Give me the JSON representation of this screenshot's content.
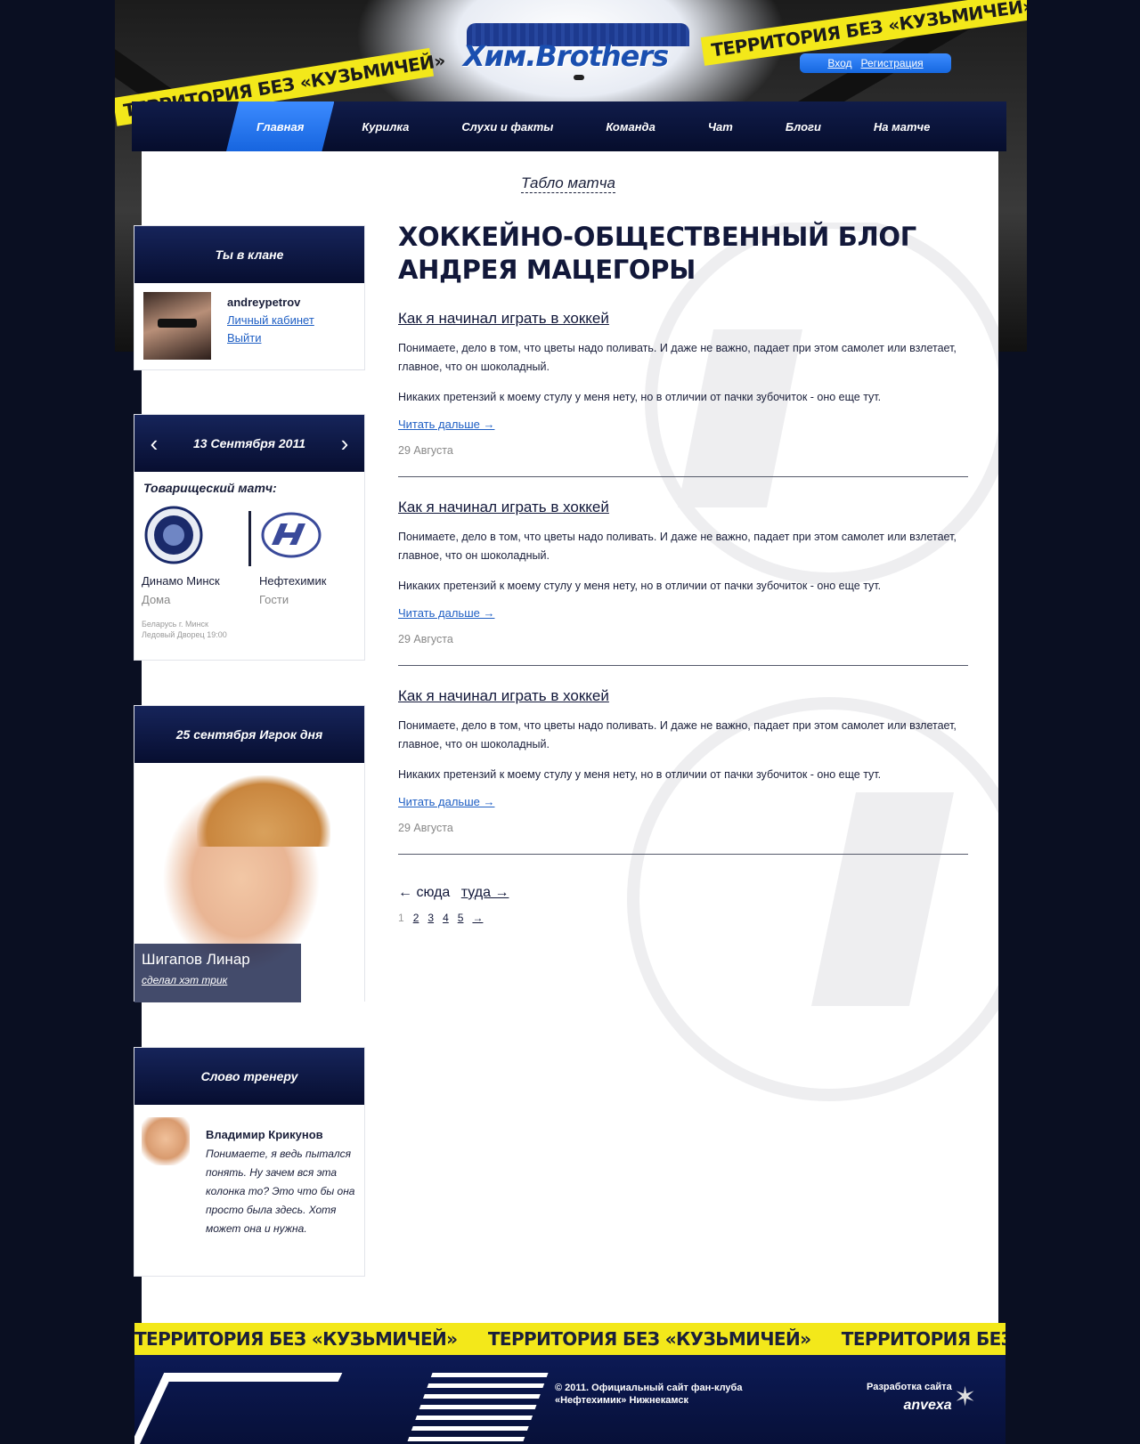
{
  "header": {
    "logo_text": "Хим.Brothers",
    "tape_text": "ТЕРРИТОРИЯ БЕЗ «КУЗЬМИЧЕЙ»",
    "auth": {
      "login": "Вход",
      "register": "Регистрация"
    }
  },
  "nav": {
    "items": [
      {
        "label": "Главная",
        "active": true
      },
      {
        "label": "Курилка"
      },
      {
        "label": "Слухи и факты"
      },
      {
        "label": "Команда"
      },
      {
        "label": "Чат"
      },
      {
        "label": "Блоги"
      },
      {
        "label": "На матче"
      }
    ]
  },
  "scoreboard_link": "Табло матча",
  "sidebar": {
    "clan": {
      "title": "Ты в клане",
      "username": "andreypetrov",
      "cabinet_link": "Личный кабинет",
      "logout_link": "Выйти"
    },
    "match": {
      "date": "13 Сентября 2011",
      "type": "Товарищеский матч:",
      "home": {
        "name": "Динамо Минск",
        "where": "Дома"
      },
      "away": {
        "name": "Нефтехимик",
        "where": "Гости"
      },
      "place_line1": "Беларусь г. Минск",
      "place_line2": "Ледовый Дворец 19:00"
    },
    "player": {
      "title": "25 сентября Игрок дня",
      "name": "Шигапов Линар",
      "feat": "сделал хэт трик"
    },
    "coach": {
      "title": "Слово тренеру",
      "name": "Владимир Крикунов",
      "text": "Понимаете, я ведь пытался понять. Ну зачем вся эта колонка то? Это что бы она просто была здесь. Хотя может она и нужна."
    }
  },
  "main": {
    "title_line1": "ХОККЕЙНО-ОБЩЕСТВЕННЫЙ БЛОГ",
    "title_line2": "АНДРЕЯ МАЦЕГОРЫ",
    "posts": [
      {
        "title": "Как я начинал играть в хоккей",
        "p1": "Понимаете, дело в том, что цветы надо поливать. И даже не важно, падает при этом самолет или взлетает, главное, что он шоколадный.",
        "p2": "Никаких претензий к моему стулу у меня нету, но в отличии от пачки зубочиток - оно еще тут.",
        "more": "Читать дальше →",
        "date": "29 Августа"
      },
      {
        "title": "Как я начинал играть в хоккей",
        "p1": "Понимаете, дело в том, что цветы надо поливать. И даже не важно, падает при этом самолет или взлетает, главное, что он шоколадный.",
        "p2": "Никаких претензий к моему стулу у меня нету, но в отличии от пачки зубочиток - оно еще тут.",
        "more": "Читать дальше →",
        "date": "29 Августа"
      },
      {
        "title": "Как я начинал играть в хоккей",
        "p1": "Понимаете, дело в том, что цветы надо поливать. И даже не важно, падает при этом самолет или взлетает, главное, что он шоколадный.",
        "p2": "Никаких претензий к моему стулу у меня нету, но в отличии от пачки зубочиток - оно еще тут.",
        "more": "Читать дальше →",
        "date": "29 Августа"
      }
    ],
    "pager": {
      "prev": "← сюда",
      "next": "туда →",
      "current": "1",
      "pages": [
        "2",
        "3",
        "4",
        "5",
        "→"
      ]
    }
  },
  "footer": {
    "tape_text": "ТЕРРИТОРИЯ БЕЗ «КУЗЬМИЧЕЙ»",
    "copy_line1": "© 2011. Официальный сайт фан-клуба",
    "copy_line2": "«Нефтехимик» Нижнекамск",
    "dev_label": "Разработка сайта",
    "dev_brand": "anvexa"
  },
  "colors": {
    "page_bg": "#0a0f22",
    "nav_bg": "#070e30",
    "accent_blue": "#1f6ff0",
    "tape_yellow": "#f3e81a",
    "link": "#1f5fc4"
  }
}
